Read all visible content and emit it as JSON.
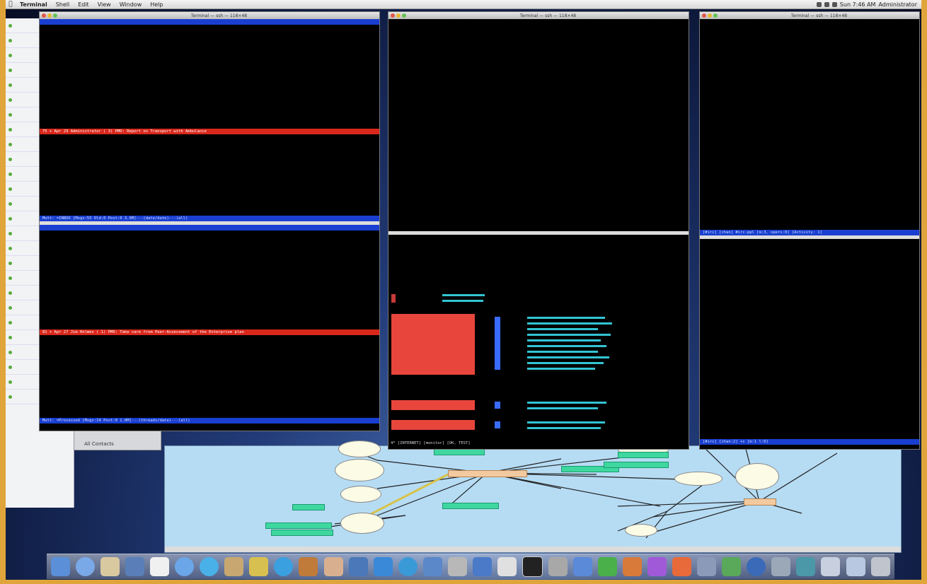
{
  "menubar": {
    "app": "Terminal",
    "items": [
      "Shell",
      "Edit",
      "View",
      "Window",
      "Help"
    ],
    "user": "Administrator",
    "clock": "Sun 7:46 AM"
  },
  "terminals": {
    "left_title": "Terminal — ssh — 118×48",
    "middle_title": "Terminal — ssh — 118×48",
    "right_title": "Terminal — ssh — 118×48"
  },
  "left_top": {
    "status": "Mutt: =INBOX [Msgs:55 Old:0 Post:0 3.9M]---(date/date)---(all)",
    "highlight": "75 + Apr 29 Administrator (  3) PMO: Report on Transport with Ambulance"
  },
  "left_bottom": {
    "status": "Mutt: =Processed [Msgs:14 Post:0 1.0M]---(threads/date)---(all)",
    "highlight": "81 + Apr 27 Jim Holmes     (  1) PMO: Take care from Peer-Assessment of the Enterprise plan"
  },
  "middle_bottom": {
    "status": "4* [INTERNET] [monitor] [OK, TEST]"
  },
  "right_top": {
    "status": "[#irc] [chan] #irc-ppl [m:3, opers:0] [Activity: 1]"
  },
  "right_bottom": {
    "status": "[#irc] [chan:2] +c [m:1 l:0]"
  },
  "sidepanel": {
    "label": "All Contacts"
  }
}
